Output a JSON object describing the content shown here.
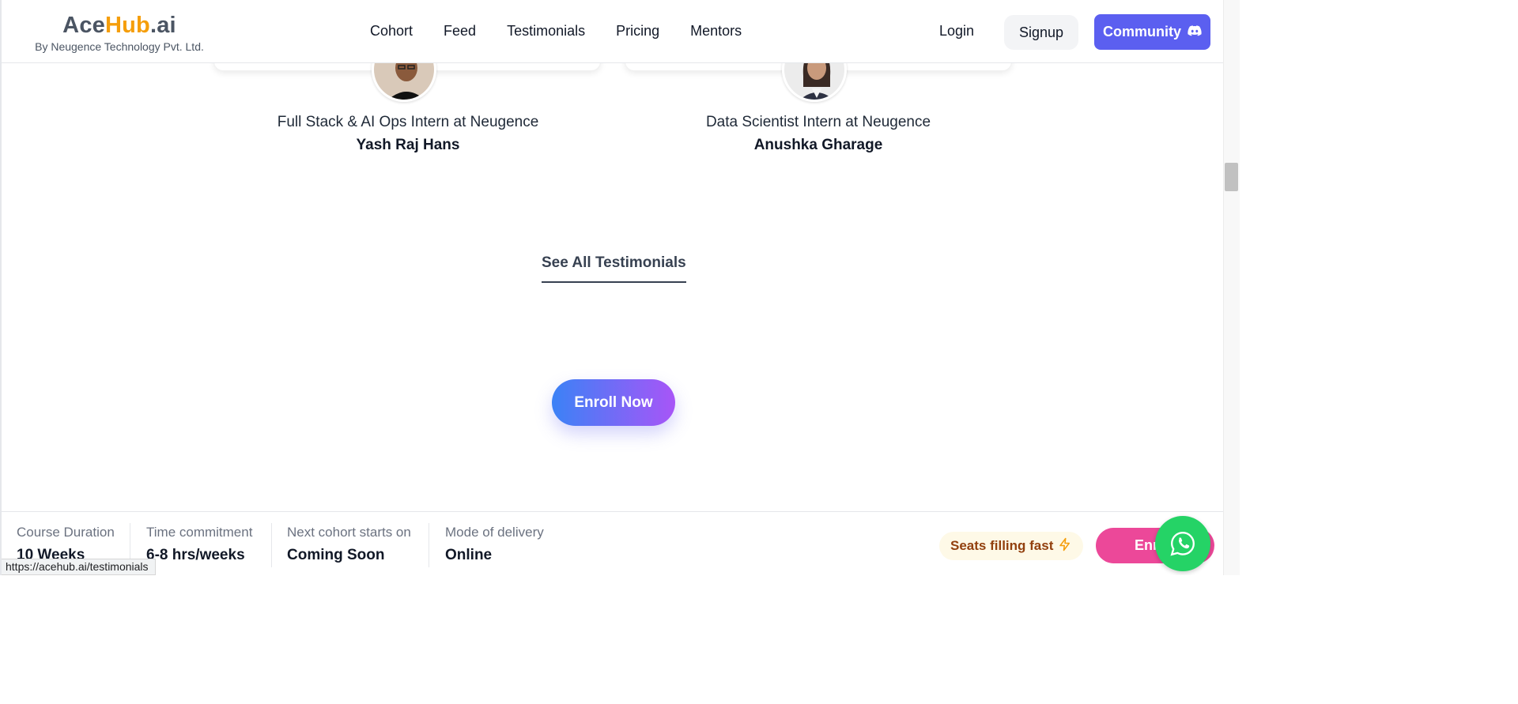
{
  "header": {
    "logo": {
      "ace": "Ace",
      "hub": "Hub",
      "ai": ".ai",
      "subtitle": "By Neugence Technology Pvt. Ltd."
    },
    "nav": [
      {
        "label": "Cohort"
      },
      {
        "label": "Feed"
      },
      {
        "label": "Testimonials"
      },
      {
        "label": "Pricing"
      },
      {
        "label": "Mentors"
      }
    ],
    "login_label": "Login",
    "signup_label": "Signup",
    "community_label": "Community"
  },
  "testimonials": [
    {
      "role": "Full Stack & AI Ops Intern at Neugence",
      "name": "Yash Raj Hans"
    },
    {
      "role": "Data Scientist Intern at Neugence",
      "name": "Anushka Gharage"
    }
  ],
  "see_all_label": "See All Testimonials",
  "enroll_now_label": "Enroll Now",
  "bottom_bar": {
    "stats": [
      {
        "label": "Course Duration",
        "value": "10 Weeks"
      },
      {
        "label": "Time commitment",
        "value": "6-8 hrs/weeks"
      },
      {
        "label": "Next cohort starts on",
        "value": "Coming Soon"
      },
      {
        "label": "Mode of delivery",
        "value": "Online"
      }
    ],
    "seats_label": "Seats filling fast",
    "enroll_label": "Enroll"
  },
  "status_url": "https://acehub.ai/testimonials",
  "colors": {
    "brand_orange": "#f59e0b",
    "community_purple": "#5b5ff0",
    "enroll_pink": "#ec4899",
    "whatsapp_green": "#25d366"
  }
}
